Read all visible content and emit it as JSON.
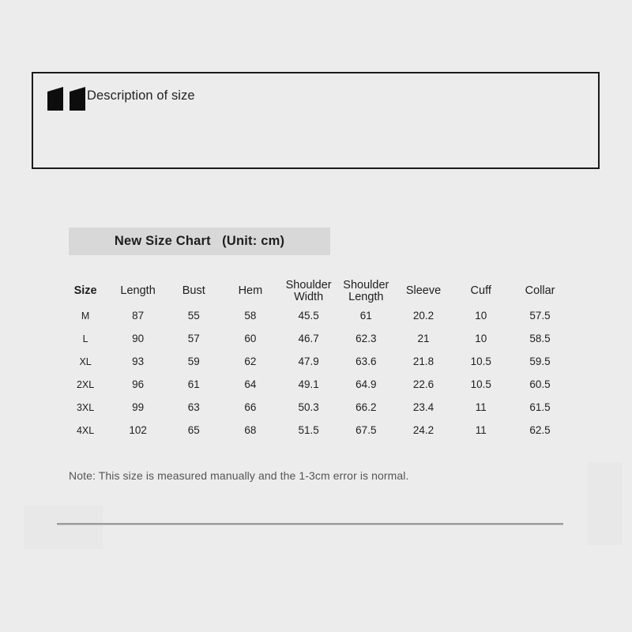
{
  "page": {
    "background_color": "#ececec"
  },
  "description_box": {
    "icon": "quote-mark-icon",
    "label": "Description of size",
    "border_color": "#1a1a1a"
  },
  "size_chart": {
    "title_bar": {
      "text": "New Size Chart   (Unit: cm)",
      "background_color": "#d8d8d8"
    },
    "columns": [
      "Size",
      "Length",
      "Bust",
      "Hem",
      "Shoulder Width",
      "Shoulder Length",
      "Sleeve",
      "Cuff",
      "Collar"
    ],
    "columns_lines": [
      [
        "Size"
      ],
      [
        "Length"
      ],
      [
        "Bust"
      ],
      [
        "Hem"
      ],
      [
        "Shoulder",
        "Width"
      ],
      [
        "Shoulder",
        "Length"
      ],
      [
        "Sleeve"
      ],
      [
        "Cuff"
      ],
      [
        "Collar"
      ]
    ],
    "rows": [
      {
        "size": "M",
        "length": "87",
        "bust": "55",
        "hem": "58",
        "shoulder_width": "45.5",
        "shoulder_length": "61",
        "sleeve": "20.2",
        "cuff": "10",
        "collar": "57.5"
      },
      {
        "size": "L",
        "length": "90",
        "bust": "57",
        "hem": "60",
        "shoulder_width": "46.7",
        "shoulder_length": "62.3",
        "sleeve": "21",
        "cuff": "10",
        "collar": "58.5"
      },
      {
        "size": "XL",
        "length": "93",
        "bust": "59",
        "hem": "62",
        "shoulder_width": "47.9",
        "shoulder_length": "63.6",
        "sleeve": "21.8",
        "cuff": "10.5",
        "collar": "59.5"
      },
      {
        "size": "2XL",
        "length": "96",
        "bust": "61",
        "hem": "64",
        "shoulder_width": "49.1",
        "shoulder_length": "64.9",
        "sleeve": "22.6",
        "cuff": "10.5",
        "collar": "60.5"
      },
      {
        "size": "3XL",
        "length": "99",
        "bust": "63",
        "hem": "66",
        "shoulder_width": "50.3",
        "shoulder_length": "66.2",
        "sleeve": "23.4",
        "cuff": "11",
        "collar": "61.5"
      },
      {
        "size": "4XL",
        "length": "102",
        "bust": "65",
        "hem": "68",
        "shoulder_width": "51.5",
        "shoulder_length": "67.5",
        "sleeve": "24.2",
        "cuff": "11",
        "collar": "62.5"
      }
    ],
    "note": "Note: This size is measured manually and the 1-3cm error is normal."
  },
  "chart_data": {
    "type": "table",
    "title": "New Size Chart   (Unit: cm)",
    "categories": [
      "M",
      "L",
      "XL",
      "2XL",
      "3XL",
      "4XL"
    ],
    "series": [
      {
        "name": "Length",
        "values": [
          87,
          90,
          93,
          96,
          99,
          102
        ]
      },
      {
        "name": "Bust",
        "values": [
          55,
          57,
          59,
          61,
          63,
          65
        ]
      },
      {
        "name": "Hem",
        "values": [
          58,
          60,
          62,
          64,
          66,
          68
        ]
      },
      {
        "name": "Shoulder Width",
        "values": [
          45.5,
          46.7,
          47.9,
          49.1,
          50.3,
          51.5
        ]
      },
      {
        "name": "Shoulder Length",
        "values": [
          61,
          62.3,
          63.6,
          64.9,
          66.2,
          67.5
        ]
      },
      {
        "name": "Sleeve",
        "values": [
          20.2,
          21,
          21.8,
          22.6,
          23.4,
          24.2
        ]
      },
      {
        "name": "Cuff",
        "values": [
          10,
          10,
          10.5,
          10.5,
          11,
          11
        ]
      },
      {
        "name": "Collar",
        "values": [
          57.5,
          58.5,
          59.5,
          60.5,
          61.5,
          62.5
        ]
      }
    ],
    "xlabel": "Size",
    "ylabel": "cm",
    "grid": false,
    "legend": "none"
  }
}
